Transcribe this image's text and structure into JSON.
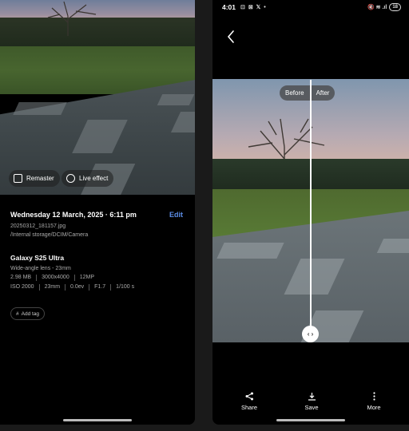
{
  "left_phone": {
    "buttons": {
      "remaster_label": "Remaster",
      "live_effect_label": "Live effect"
    },
    "details": {
      "date": "Wednesday 12 March, 2025 · 6:11 pm",
      "edit_label": "Edit",
      "filename": "20250312_181157.jpg",
      "path": "/Internal storage/DCIM/Camera",
      "model": "Galaxy S25 Ultra",
      "lens": "Wide-angle lens - 23mm",
      "file_specs": [
        "2.98 MB",
        "3000x4000",
        "12MP"
      ],
      "exposure_specs": [
        "ISO 2000",
        "23mm",
        "0.0ev",
        "F1.7",
        "1/100 s"
      ],
      "add_tag_label": "Add tag"
    }
  },
  "right_phone": {
    "status_bar": {
      "time": "4:01",
      "notification_icons": "⊡ ⊠ 𝕏 •",
      "system_icons": "🔇 ≋ .ıl",
      "battery": "18"
    },
    "compare": {
      "before_label": "Before",
      "after_label": "After"
    },
    "actions": [
      {
        "label": "Share",
        "icon": "share-icon"
      },
      {
        "label": "Save",
        "icon": "download-icon"
      },
      {
        "label": "More",
        "icon": "more-vertical-icon"
      }
    ]
  },
  "colors": {
    "accent_blue": "#5c8ee8",
    "background": "#000000"
  }
}
